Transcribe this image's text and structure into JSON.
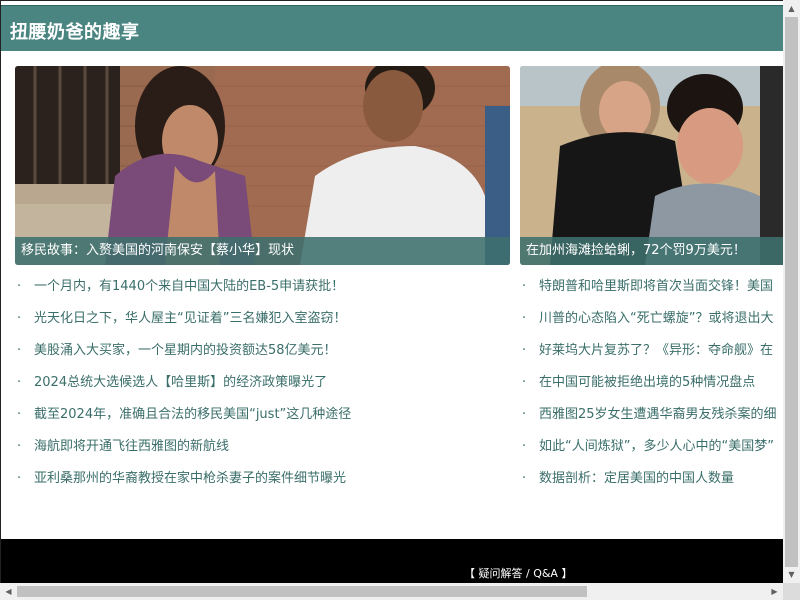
{
  "header": {
    "title": "扭腰奶爸的趣享"
  },
  "cards": [
    {
      "caption": "移民故事：入赘美国的河南保安【蔡小华】现状"
    },
    {
      "caption": "在加州海滩捡蛤蜊，72个罚9万美元！"
    }
  ],
  "news_left": [
    "一个月内，有1440个来自中国大陆的EB-5申请获批！",
    "光天化日之下，华人屋主“见证着”三名嫌犯入室盗窃！",
    "美股涌入大买家，一个星期内的投资额达58亿美元！",
    "2024总统大选候选人【哈里斯】的经济政策曝光了",
    "截至2024年，准确且合法的移民美国“just”这几种途径",
    "海航即将开通飞往西雅图的新航线",
    "亚利桑那州的华裔教授在家中枪杀妻子的案件细节曝光"
  ],
  "news_right": [
    "特朗普和哈里斯即将首次当面交锋！美国",
    "川普的心态陷入“死亡螺旋”？或将退出大",
    "好莱坞大片复苏了？《异形：夺命舰》在",
    "在中国可能被拒绝出境的5种情况盘点",
    "西雅图25岁女生遭遇华裔男友残杀案的细",
    "如此“人间炼狱”，多少人心中的“美国梦”",
    "数据剖析：定居美国的中国人数量"
  ],
  "footer": {
    "link": "【 疑问解答 / Q&A 】"
  },
  "bullet": "·",
  "colors": {
    "header_bg": "#4a8581",
    "link": "#3a6e6a",
    "footer_bg": "#000000"
  }
}
